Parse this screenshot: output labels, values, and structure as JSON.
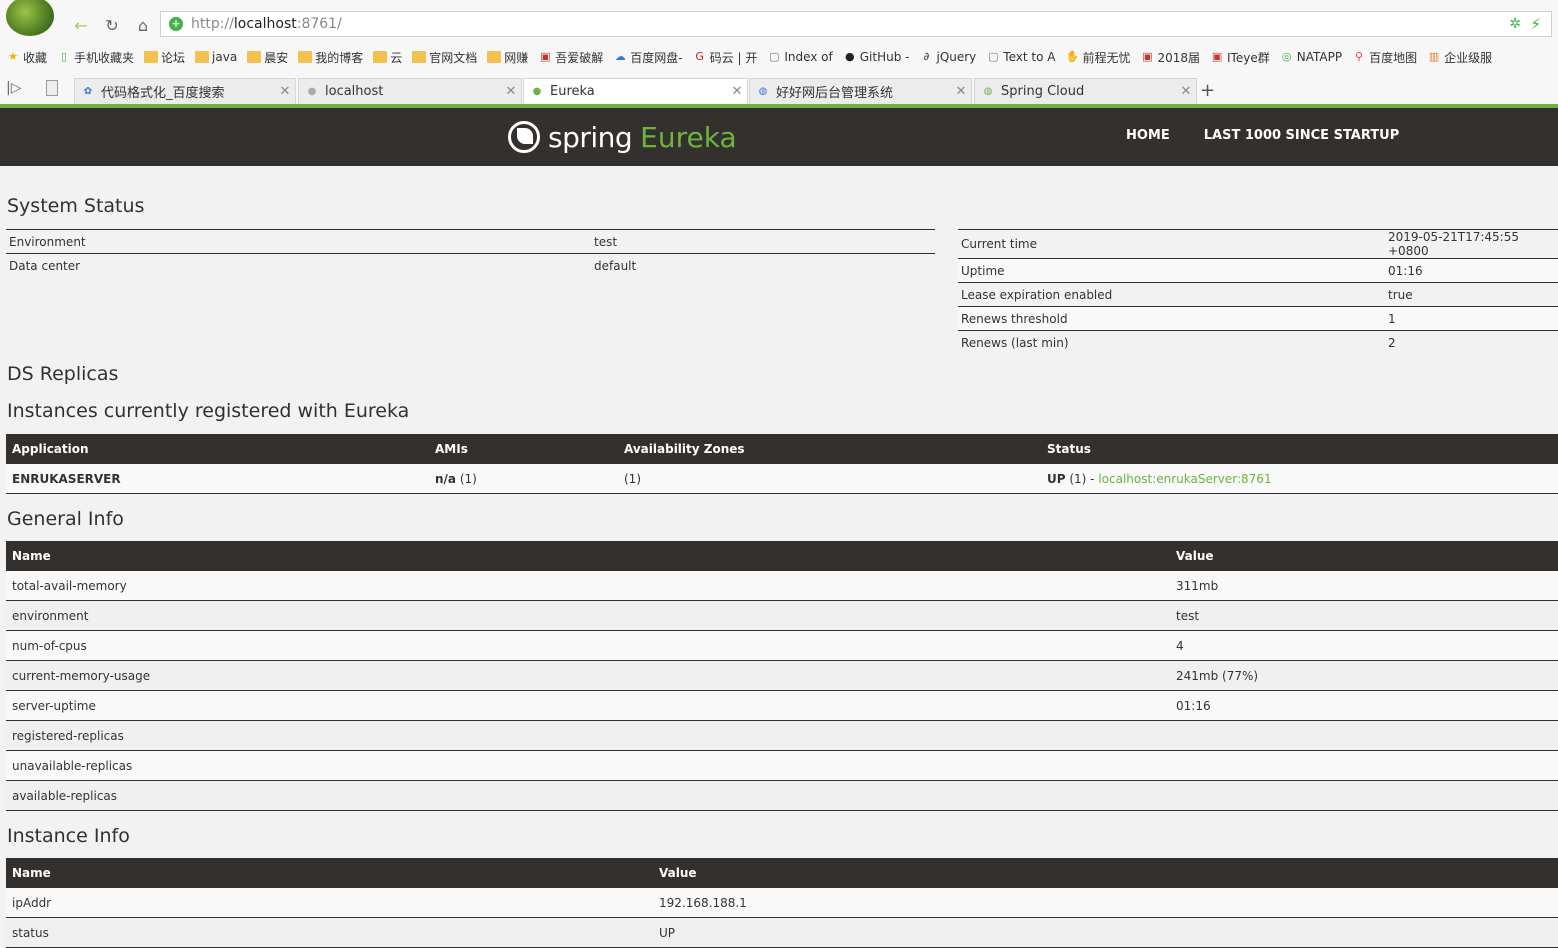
{
  "browser": {
    "url_prefix": "http://",
    "url_host": "localhost",
    "url_rest": ":8761/",
    "bookmarks": [
      {
        "label": "收藏",
        "icon": "star-icon"
      },
      {
        "label": "手机收藏夹",
        "icon": "phone-icon"
      },
      {
        "label": "论坛",
        "icon": "folder-icon"
      },
      {
        "label": "java",
        "icon": "folder-icon"
      },
      {
        "label": "晨安",
        "icon": "folder-icon"
      },
      {
        "label": "我的博客",
        "icon": "folder-icon"
      },
      {
        "label": "云",
        "icon": "folder-icon"
      },
      {
        "label": "官网文档",
        "icon": "folder-icon"
      },
      {
        "label": "网赚",
        "icon": "folder-icon"
      },
      {
        "label": "吾爱破解",
        "icon": "app-icon"
      },
      {
        "label": "百度网盘-",
        "icon": "cloud-icon"
      },
      {
        "label": "码云 | 开",
        "icon": "gitee-icon"
      },
      {
        "label": "Index of",
        "icon": "page-icon"
      },
      {
        "label": "GitHub -",
        "icon": "github-icon"
      },
      {
        "label": "jQuery",
        "icon": "jquery-icon"
      },
      {
        "label": "Text to A",
        "icon": "page-icon"
      },
      {
        "label": "前程无忧",
        "icon": "hand-icon"
      },
      {
        "label": "2018届",
        "icon": "app-icon"
      },
      {
        "label": "ITeye群",
        "icon": "app-icon"
      },
      {
        "label": "NATAPP",
        "icon": "globe-icon"
      },
      {
        "label": "百度地图",
        "icon": "pin-icon"
      },
      {
        "label": "企业级服",
        "icon": "chart-icon"
      }
    ],
    "tabs": [
      {
        "label": "代码格式化_百度搜索"
      },
      {
        "label": "localhost"
      },
      {
        "label": "Eureka"
      },
      {
        "label": "好好网后台管理系统"
      },
      {
        "label": "Spring Cloud"
      }
    ]
  },
  "header": {
    "brand_spring": "spring",
    "brand_eureka": "Eureka",
    "nav": [
      "HOME",
      "LAST 1000 SINCE STARTUP"
    ]
  },
  "system_status": {
    "title": "System Status",
    "left": [
      {
        "key": "Environment",
        "value": "test"
      },
      {
        "key": "Data center",
        "value": "default"
      }
    ],
    "right": [
      {
        "key": "Current time",
        "value": "2019-05-21T17:45:55 +0800"
      },
      {
        "key": "Uptime",
        "value": "01:16"
      },
      {
        "key": "Lease expiration enabled",
        "value": "true"
      },
      {
        "key": "Renews threshold",
        "value": "1"
      },
      {
        "key": "Renews (last min)",
        "value": "2"
      }
    ]
  },
  "ds_replicas": {
    "title": "DS Replicas"
  },
  "instances": {
    "title": "Instances currently registered with Eureka",
    "headers": [
      "Application",
      "AMIs",
      "Availability Zones",
      "Status"
    ],
    "rows": [
      {
        "application": "ENRUKASERVER",
        "amis_bold": "n/a",
        "amis_rest": " (1)",
        "zones": "(1)",
        "status_bold": "UP",
        "status_rest": " (1) - ",
        "status_link": "localhost:enrukaServer:8761"
      }
    ]
  },
  "general_info": {
    "title": "General Info",
    "headers": [
      "Name",
      "Value"
    ],
    "rows": [
      {
        "name": "total-avail-memory",
        "value": "311mb"
      },
      {
        "name": "environment",
        "value": "test"
      },
      {
        "name": "num-of-cpus",
        "value": "4"
      },
      {
        "name": "current-memory-usage",
        "value": "241mb (77%)"
      },
      {
        "name": "server-uptime",
        "value": "01:16"
      },
      {
        "name": "registered-replicas",
        "value": ""
      },
      {
        "name": "unavailable-replicas",
        "value": ""
      },
      {
        "name": "available-replicas",
        "value": ""
      }
    ]
  },
  "instance_info": {
    "title": "Instance Info",
    "headers": [
      "Name",
      "Value"
    ],
    "rows": [
      {
        "name": "ipAddr",
        "value": "192.168.188.1"
      },
      {
        "name": "status",
        "value": "UP"
      }
    ]
  }
}
